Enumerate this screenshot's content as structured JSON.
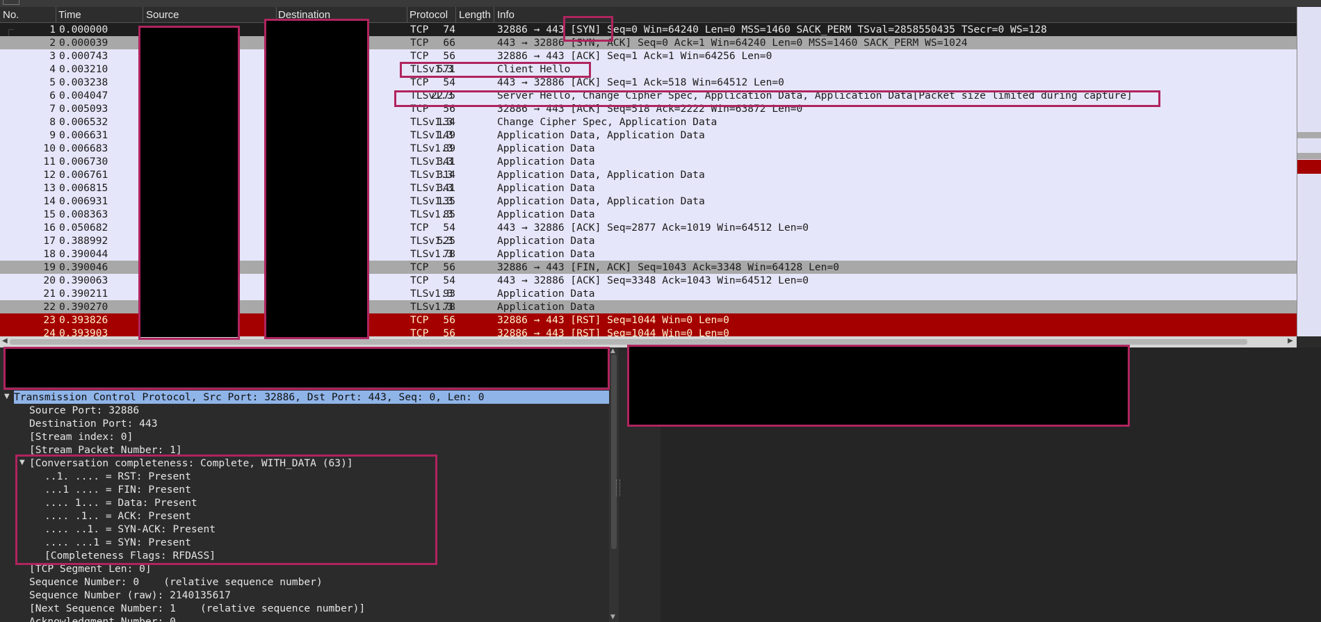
{
  "packet_list": {
    "columns": [
      "No.",
      "Time",
      "Source",
      "Destination",
      "Protocol",
      "Length",
      "Info"
    ],
    "rows": [
      {
        "no": "1",
        "time": "0.000000",
        "proto": "TCP",
        "len": "74",
        "info": "32886 → 443 [SYN] Seq=0 Win=64240 Len=0 MSS=1460 SACK_PERM TSval=2858550435 TSecr=0 WS=128",
        "style": "sel"
      },
      {
        "no": "2",
        "time": "0.000039",
        "proto": "TCP",
        "len": "66",
        "info": "443 → 32886 [SYN, ACK] Seq=0 Ack=1 Win=64240 Len=0 MSS=1460 SACK_PERM WS=1024",
        "style": "grey"
      },
      {
        "no": "3",
        "time": "0.000743",
        "proto": "TCP",
        "len": "56",
        "info": "32886 → 443 [ACK] Seq=1 Ack=1 Win=64256 Len=0",
        "style": "normal"
      },
      {
        "no": "4",
        "time": "0.003210",
        "proto": "TLSv1.3",
        "len": "571",
        "info": "Client Hello",
        "style": "normal"
      },
      {
        "no": "5",
        "time": "0.003238",
        "proto": "TCP",
        "len": "54",
        "info": "443 → 32886 [ACK] Seq=1 Ack=518 Win=64512 Len=0",
        "style": "normal"
      },
      {
        "no": "6",
        "time": "0.004047",
        "proto": "TLSv1.3",
        "len": "2275",
        "info": "Server Hello, Change Cipher Spec, Application Data, Application Data[Packet size limited during capture]",
        "style": "normal"
      },
      {
        "no": "7",
        "time": "0.005093",
        "proto": "TCP",
        "len": "56",
        "info": "32886 → 443 [ACK] Seq=518 Ack=2222 Win=63872 Len=0",
        "style": "normal"
      },
      {
        "no": "8",
        "time": "0.006532",
        "proto": "TLSv1.3",
        "len": "134",
        "info": "Change Cipher Spec, Application Data",
        "style": "normal"
      },
      {
        "no": "9",
        "time": "0.006631",
        "proto": "TLSv1.3",
        "len": "149",
        "info": "Application Data, Application Data",
        "style": "normal"
      },
      {
        "no": "10",
        "time": "0.006683",
        "proto": "TLSv1.3",
        "len": "89",
        "info": "Application Data",
        "style": "normal"
      },
      {
        "no": "11",
        "time": "0.006730",
        "proto": "TLSv1.3",
        "len": "341",
        "info": "Application Data",
        "style": "normal"
      },
      {
        "no": "12",
        "time": "0.006761",
        "proto": "TLSv1.3",
        "len": "314",
        "info": "Application Data, Application Data",
        "style": "normal"
      },
      {
        "no": "13",
        "time": "0.006815",
        "proto": "TLSv1.3",
        "len": "341",
        "info": "Application Data",
        "style": "normal"
      },
      {
        "no": "14",
        "time": "0.006931",
        "proto": "TLSv1.3",
        "len": "135",
        "info": "Application Data, Application Data",
        "style": "normal"
      },
      {
        "no": "15",
        "time": "0.008363",
        "proto": "TLSv1.3",
        "len": "85",
        "info": "Application Data",
        "style": "normal"
      },
      {
        "no": "16",
        "time": "0.050682",
        "proto": "TCP",
        "len": "54",
        "info": "443 → 32886 [ACK] Seq=2877 Ack=1019 Win=64512 Len=0",
        "style": "normal"
      },
      {
        "no": "17",
        "time": "0.388992",
        "proto": "TLSv1.3",
        "len": "525",
        "info": "Application Data",
        "style": "normal"
      },
      {
        "no": "18",
        "time": "0.390044",
        "proto": "TLSv1.3",
        "len": "78",
        "info": "Application Data",
        "style": "normal"
      },
      {
        "no": "19",
        "time": "0.390046",
        "proto": "TCP",
        "len": "56",
        "info": "32886 → 443 [FIN, ACK] Seq=1043 Ack=3348 Win=64128 Len=0",
        "style": "grey"
      },
      {
        "no": "20",
        "time": "0.390063",
        "proto": "TCP",
        "len": "54",
        "info": "443 → 32886 [ACK] Seq=3348 Ack=1043 Win=64512 Len=0",
        "style": "normal"
      },
      {
        "no": "21",
        "time": "0.390211",
        "proto": "TLSv1.3",
        "len": "93",
        "info": "Application Data",
        "style": "normal"
      },
      {
        "no": "22",
        "time": "0.390270",
        "proto": "TLSv1.3",
        "len": "78",
        "info": "Application Data",
        "style": "grey"
      },
      {
        "no": "23",
        "time": "0.393826",
        "proto": "TCP",
        "len": "56",
        "info": "32886 → 443 [RST] Seq=1044 Win=0 Len=0",
        "style": "rst"
      },
      {
        "no": "24",
        "time": "0.393903",
        "proto": "TCP",
        "len": "56",
        "info": "32886 → 443 [RST] Seq=1044 Win=0 Len=0",
        "style": "rst"
      }
    ]
  },
  "detail": {
    "lines": [
      {
        "text": "Transmission Control Protocol, Src Port: 32886, Dst Port: 443, Seq: 0, Len: 0",
        "indent": 0,
        "expanded": true,
        "selected": true
      },
      {
        "text": "Source Port: 32886",
        "indent": 1
      },
      {
        "text": "Destination Port: 443",
        "indent": 1
      },
      {
        "text": "[Stream index: 0]",
        "indent": 1
      },
      {
        "text": "[Stream Packet Number: 1]",
        "indent": 1
      },
      {
        "text": "[Conversation completeness: Complete, WITH_DATA (63)]",
        "indent": 1,
        "expanded": true
      },
      {
        "text": "..1. .... = RST: Present",
        "indent": 2
      },
      {
        "text": "...1 .... = FIN: Present",
        "indent": 2
      },
      {
        "text": ".... 1... = Data: Present",
        "indent": 2
      },
      {
        "text": ".... .1.. = ACK: Present",
        "indent": 2
      },
      {
        "text": ".... ..1. = SYN-ACK: Present",
        "indent": 2
      },
      {
        "text": ".... ...1 = SYN: Present",
        "indent": 2
      },
      {
        "text": "[Completeness Flags: RFDASS]",
        "indent": 2
      },
      {
        "text": "[TCP Segment Len: 0]",
        "indent": 1
      },
      {
        "text": "Sequence Number: 0    (relative sequence number)",
        "indent": 1
      },
      {
        "text": "Sequence Number (raw): 2140135617",
        "indent": 1
      },
      {
        "text": "[Next Sequence Number: 1    (relative sequence number)]",
        "indent": 1
      },
      {
        "text": "Acknowledgment Number: 0",
        "indent": 1
      }
    ]
  },
  "colors": {
    "selected_row": "#1e1e1e",
    "grey_row": "#a8a8a8",
    "rst_row": "#a40000",
    "list_bg": "#e6e6fa",
    "highlight_box": "#b0245e",
    "detail_selected": "#8fb4e8"
  }
}
